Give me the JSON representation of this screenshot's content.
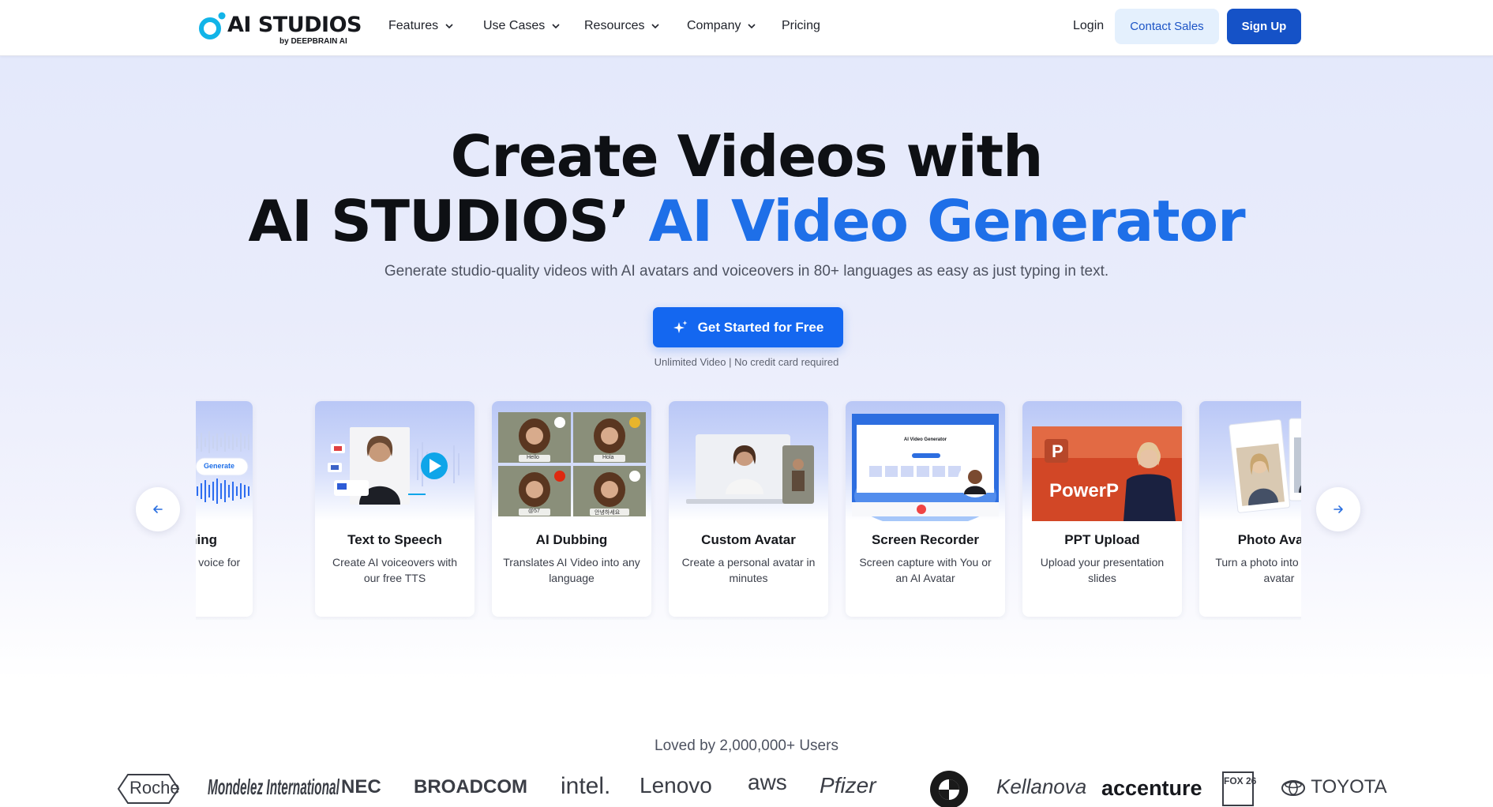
{
  "brand": {
    "logo_text": "AI STUDIOS",
    "logo_sub": "by DEEPBRAIN AI",
    "accent_color": "#1e6fe8",
    "primary_button_color": "#1467f0"
  },
  "nav": {
    "items": [
      {
        "label": "Features",
        "has_dropdown": true
      },
      {
        "label": "Use Cases",
        "has_dropdown": true
      },
      {
        "label": "Resources",
        "has_dropdown": true
      },
      {
        "label": "Company",
        "has_dropdown": true
      },
      {
        "label": "Pricing",
        "has_dropdown": false
      }
    ],
    "login": "Login",
    "contact_sales": "Contact Sales",
    "sign_up": "Sign Up"
  },
  "hero": {
    "title_line1": "Create Videos with",
    "title_line2_prefix": "AI STUDIOS’",
    "title_line2_accent": "AI Video Generator",
    "subtitle": "Generate studio-quality videos with AI avatars and voiceovers in 80+ languages as easy as just typing in text.",
    "cta_label": "Get Started for Free",
    "cta_icon": "sparkle-icon",
    "cta_note": "Unlimited Video | No credit card required"
  },
  "carousel": {
    "prev_icon": "arrow-left-icon",
    "next_icon": "arrow-right-icon",
    "cards": [
      {
        "title": "Voice Cloning",
        "desc": "Clone your own AI voice for TTS",
        "image_text": "Generate"
      },
      {
        "title": "Text to Speech",
        "desc": "Create AI voiceovers with our free TTS"
      },
      {
        "title": "AI Dubbing",
        "desc": "Translates AI Video into any language",
        "image_labels": [
          "Hello",
          "Hola",
          "@57",
          "안녕하세요"
        ]
      },
      {
        "title": "Custom Avatar",
        "desc": "Create a personal avatar in minutes"
      },
      {
        "title": "Screen Recorder",
        "desc": "Screen capture with You or an AI Avatar",
        "image_text": "AI Video Generator"
      },
      {
        "title": "PPT Upload",
        "desc": "Upload your presentation slides",
        "image_text": "PowerP"
      },
      {
        "title": "Photo Avatar",
        "desc": "Turn a photo into a talking avatar"
      }
    ]
  },
  "social_proof": {
    "heading": "Loved by 2,000,000+ Users",
    "logos": [
      "Roche",
      "Mondelez International",
      "NEC",
      "BROADCOM",
      "intel.",
      "Lenovo",
      "aws",
      "Pfizer",
      "BMW",
      "Kellanova",
      "accenture",
      "FOX 26",
      "TOYOTA"
    ]
  }
}
